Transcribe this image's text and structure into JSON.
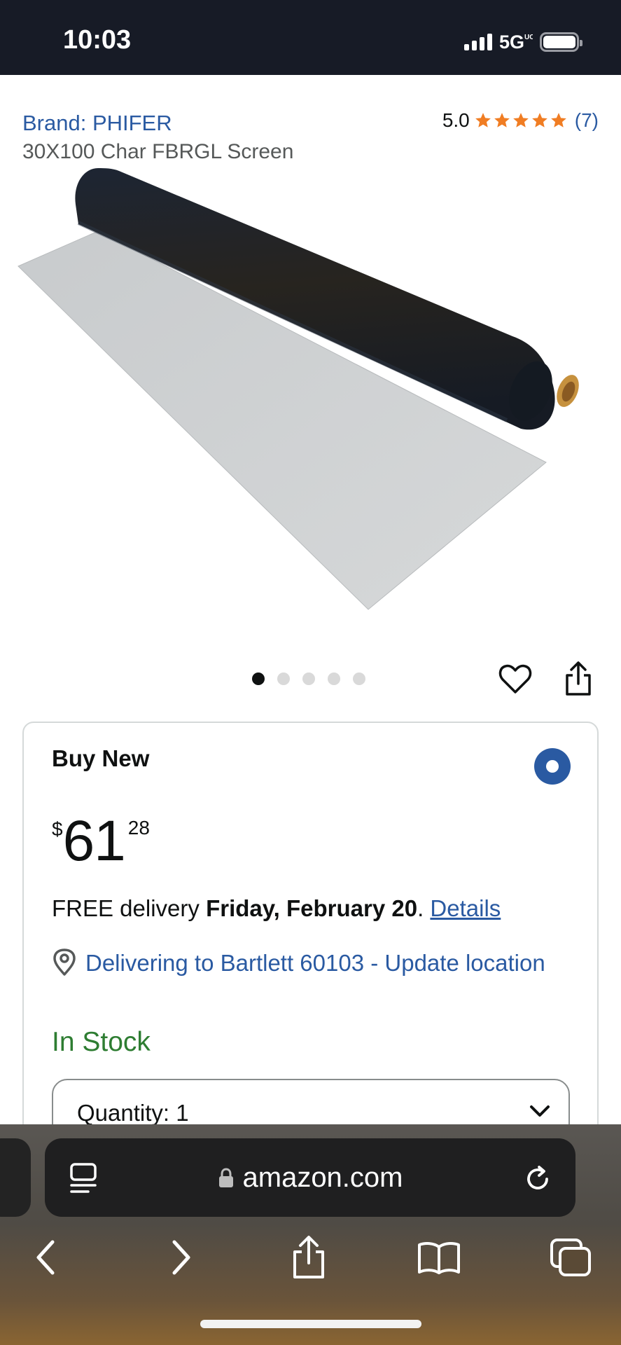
{
  "status_bar": {
    "time": "10:03",
    "network": "5G",
    "network_suffix": "UC",
    "icons": [
      "signal-icon",
      "battery-icon"
    ]
  },
  "product": {
    "brand": "Brand: PHIFER",
    "rating_value": "5.0",
    "rating_stars": 5,
    "rating_count": "(7)",
    "title": "30X100 Char FBRGL Screen"
  },
  "carousel": {
    "image_count": 5,
    "active_index": 0
  },
  "buy_box": {
    "title": "Buy New",
    "price_symbol": "$",
    "price_whole": "61",
    "price_fraction": "28",
    "delivery_prefix": "FREE delivery ",
    "delivery_date": "Friday, February 20",
    "delivery_suffix": ". ",
    "details_link": "Details",
    "location": "Delivering to Bartlett 60103 - Update location",
    "stock": "In Stock",
    "quantity_label": "Quantity:",
    "quantity_value": "1"
  },
  "browser": {
    "url": "amazon.com",
    "nav_icons": [
      "back-icon",
      "forward-icon",
      "share-icon",
      "bookmarks-icon",
      "tabs-icon"
    ]
  },
  "colors": {
    "link": "#2a5aa2",
    "star": "#f07d23",
    "stock_green": "#2e7d32",
    "status_bar_bg": "#171b26"
  }
}
